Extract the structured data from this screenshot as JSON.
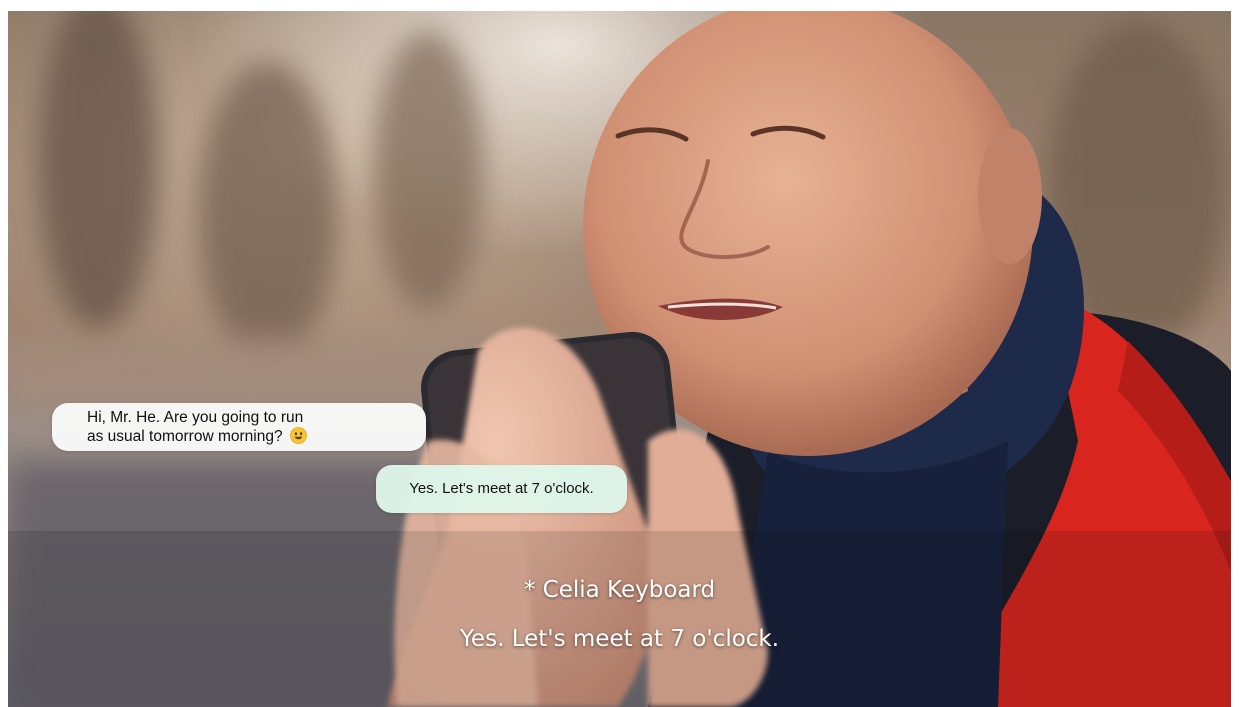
{
  "chat": {
    "incoming_line1": "Hi, Mr. He. Are you going to run",
    "incoming_line2": "as usual tomorrow morning?",
    "incoming_emoji": "smiling-face-emoji",
    "outgoing": "Yes. Let's meet at 7 o'clock."
  },
  "caption": {
    "title": "* Celia Keyboard",
    "text": "Yes. Let's meet at 7 o'clock."
  },
  "colors": {
    "incoming_bubble": "#fafafa",
    "outgoing_bubble": "#def5e9",
    "jacket_red": "#d8261f",
    "hood_navy": "#1d2a4a"
  }
}
